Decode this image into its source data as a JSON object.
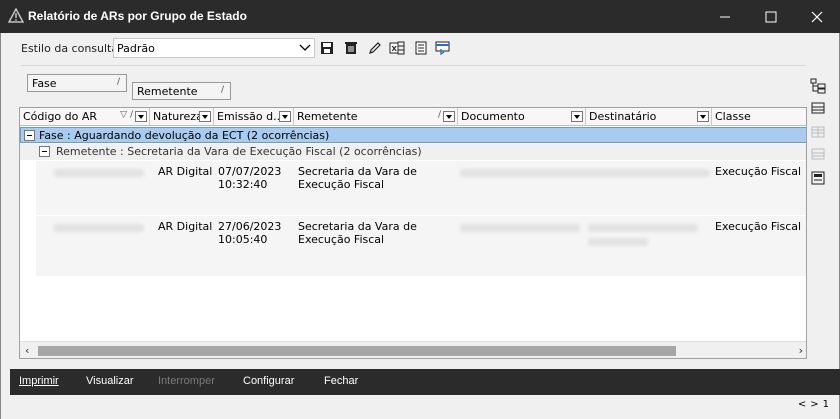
{
  "window": {
    "title": "Relatório de ARs por Grupo de Estado",
    "icon": "warning-triangle-icon"
  },
  "toolbar": {
    "estilo_label": "Estilo da consulta",
    "estilo_value": "Padrão",
    "icons": [
      "save-icon",
      "delete-icon",
      "edit-icon",
      "excel-export-icon",
      "report-icon",
      "print-preview-icon"
    ]
  },
  "grouping": {
    "chips": [
      {
        "label": "Fase",
        "sort": "/"
      },
      {
        "label": "Remetente",
        "sort": "/"
      }
    ]
  },
  "grid": {
    "columns": [
      {
        "label": "Código do AR",
        "sort": "▽ /"
      },
      {
        "label": "Natureza"
      },
      {
        "label": "Emissão d..."
      },
      {
        "label": "Remetente",
        "sort": "/"
      },
      {
        "label": "Documento"
      },
      {
        "label": "Destinatário"
      },
      {
        "label": "Classe"
      }
    ],
    "group1": "Fase : Aguardando devolução da ECT (2 ocorrências)",
    "group2": "Remetente : Secretaria da Vara de Execução Fiscal (2 ocorrências)",
    "rows": [
      {
        "natureza": "AR Digital",
        "emissao": "07/07/2023 10:32:40",
        "remetente": "Secretaria da Vara de Execução Fiscal",
        "classe": "Execução Fiscal"
      },
      {
        "natureza": "AR Digital",
        "emissao": "27/06/2023 10:05:40",
        "remetente": "Secretaria da Vara de Execução Fiscal",
        "classe": "Execução Fiscal"
      }
    ]
  },
  "footer": {
    "imprimir": "Imprimir",
    "visualizar": "Visualizar",
    "interromper": "Interromper",
    "configurar": "Configurar",
    "fechar": "Fechar"
  },
  "pager": {
    "prev": "<",
    "next": ">",
    "page": "1"
  }
}
